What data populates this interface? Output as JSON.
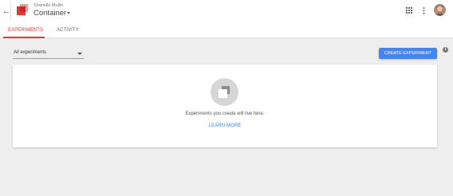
{
  "header": {
    "back_icon": "arrow-back-icon",
    "logo_icon": "optimize-logo-icon",
    "account_name": "Shanelle Mullin",
    "container_name": "Container",
    "apps_icon": "apps-grid-icon",
    "more_icon": "more-vert-icon",
    "avatar": "user-avatar"
  },
  "tabs": [
    {
      "label": "EXPERIMENTS",
      "active": true
    },
    {
      "label": "ACTIVITY",
      "active": false
    }
  ],
  "filter": {
    "selected": "All experiments"
  },
  "create_button": {
    "label": "CREATE EXPERIMENT"
  },
  "info_icon": "info-icon",
  "empty_state": {
    "icon": "experiment-placeholder-icon",
    "message": "Experiments you create will live here.",
    "link": "LEARN MORE"
  },
  "colors": {
    "accent_red": "#e53935",
    "primary_blue": "#4285f4",
    "background": "#eeeeee"
  }
}
